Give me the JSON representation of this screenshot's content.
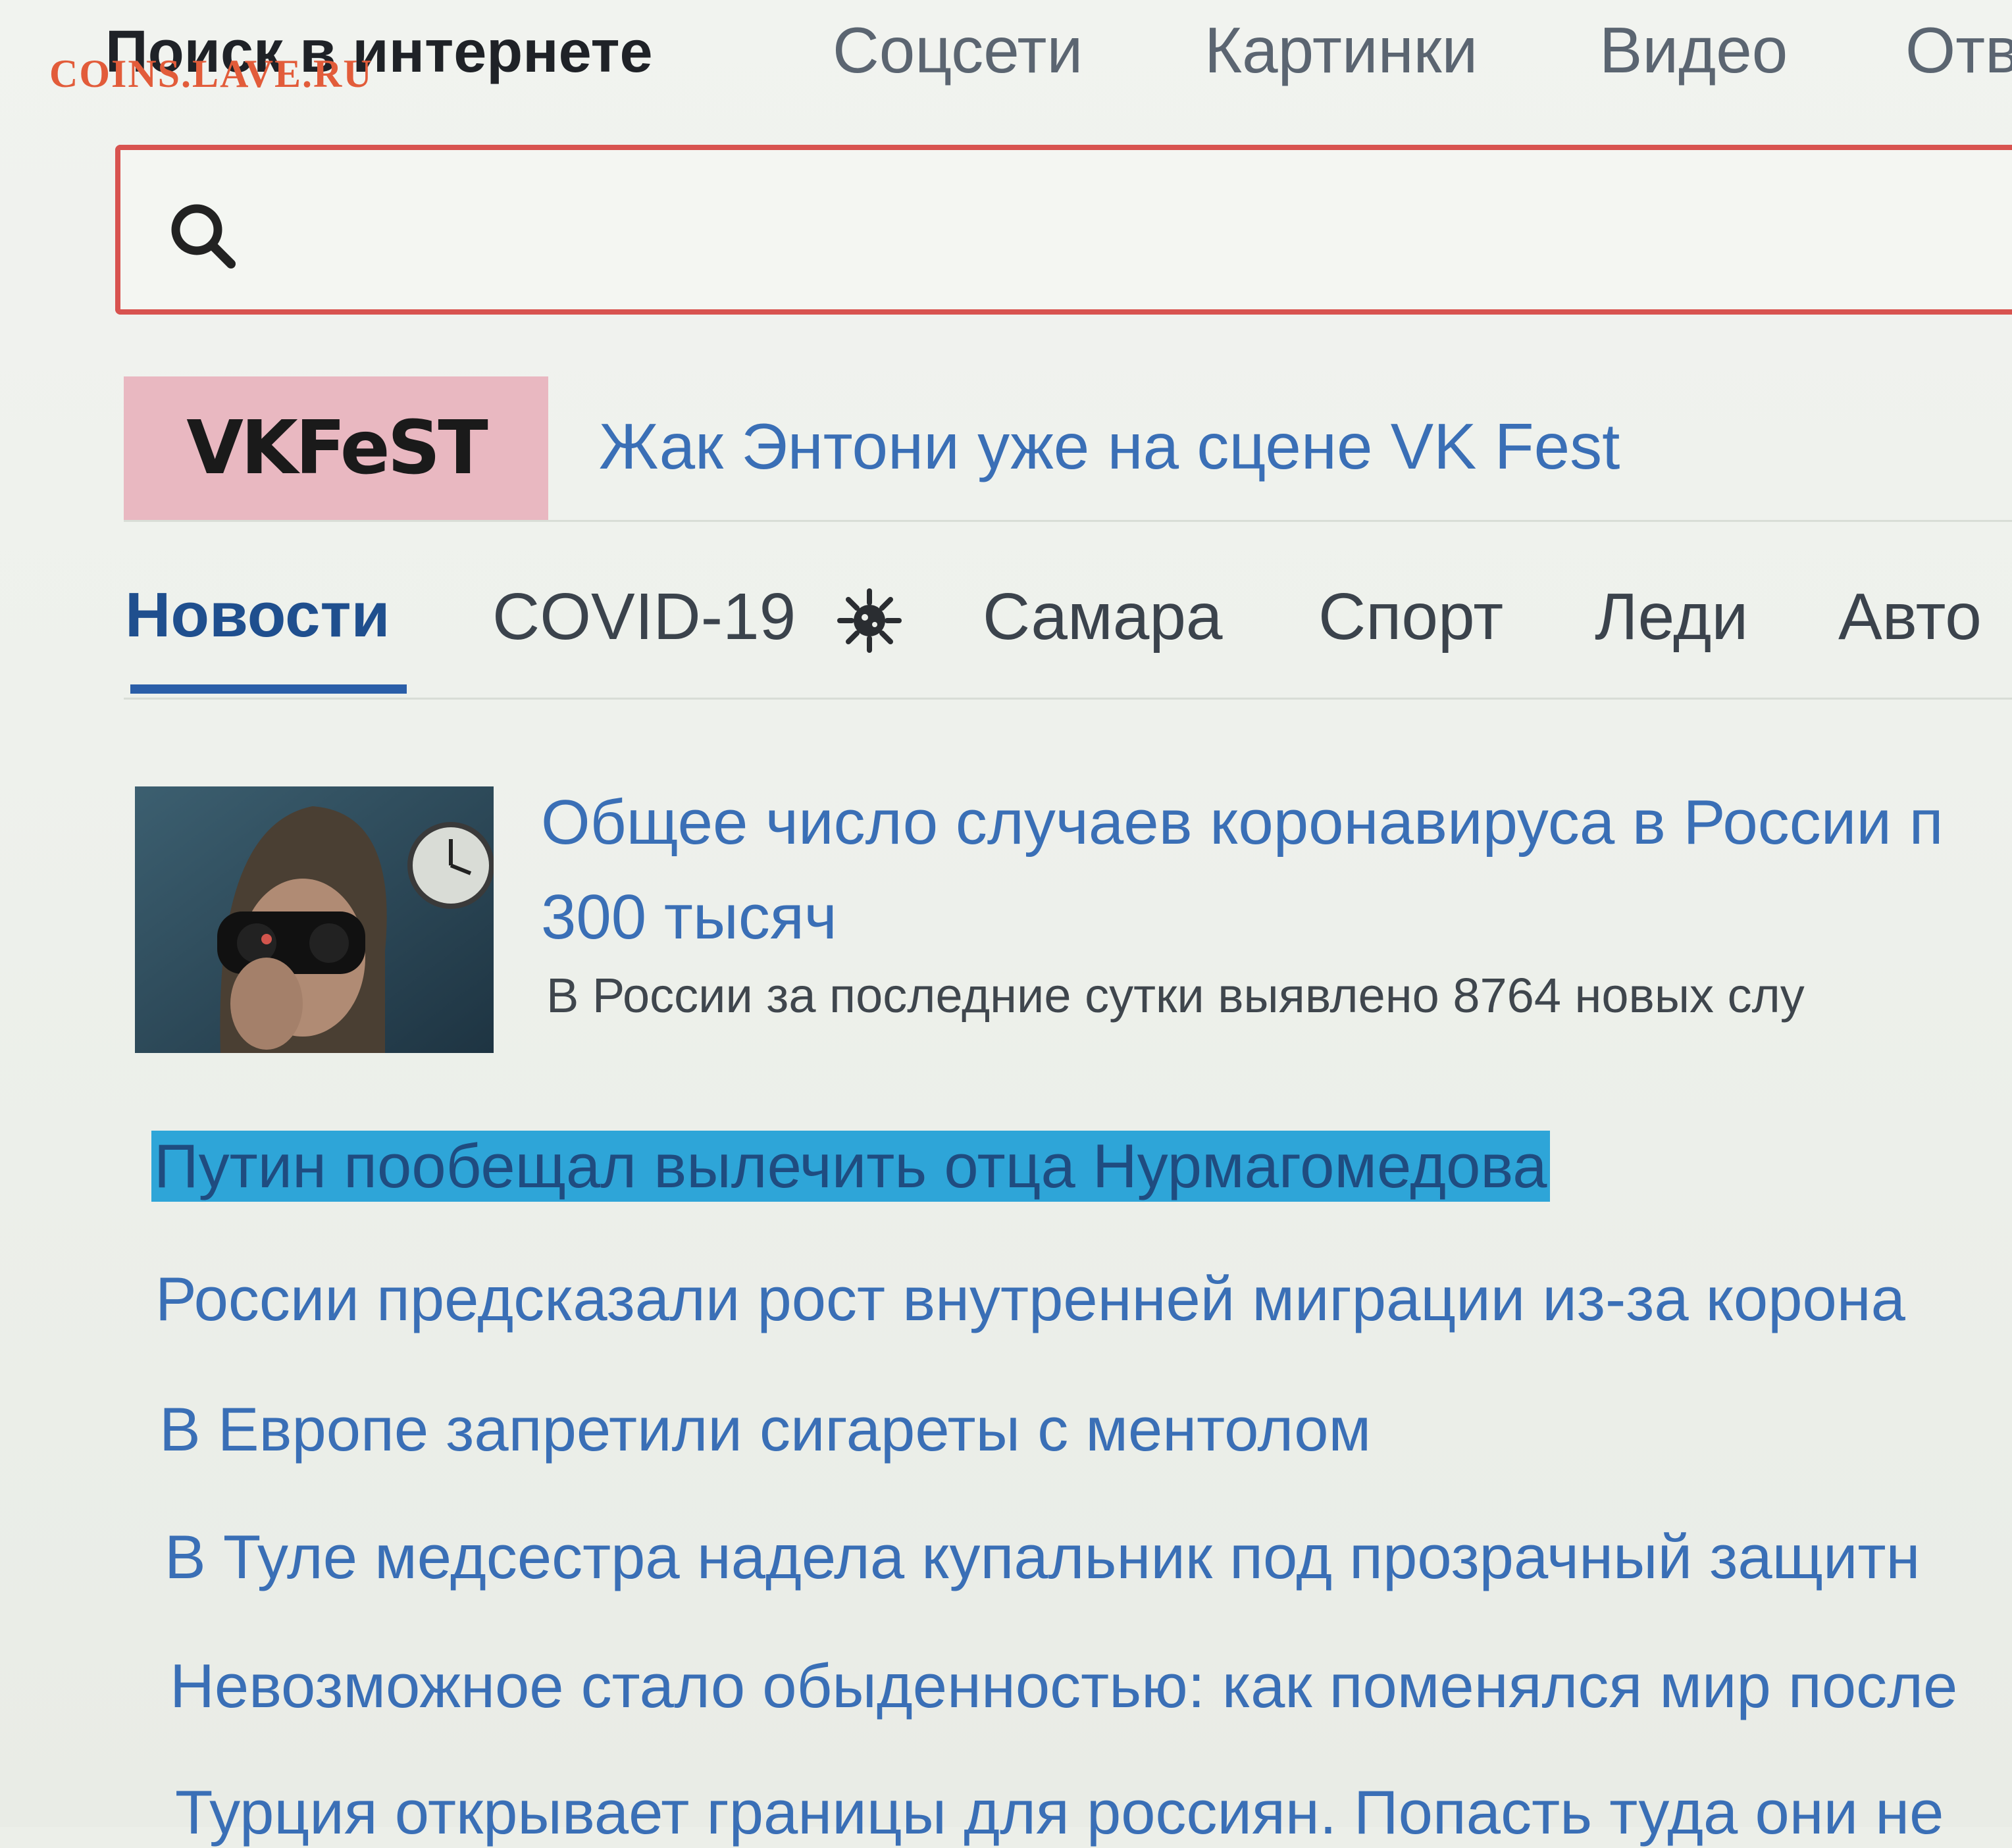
{
  "watermark": "COINS.LAVE.RU",
  "top_tabs": [
    {
      "label": "Поиск в интернете",
      "active": true
    },
    {
      "label": "Соцсети",
      "active": false
    },
    {
      "label": "Картинки",
      "active": false
    },
    {
      "label": "Видео",
      "active": false
    },
    {
      "label": "Отв",
      "active": false
    }
  ],
  "search": {
    "icon": "search-icon",
    "value": ""
  },
  "promo": {
    "logo_text": "VKFeST",
    "link_text": "Жак Энтони уже на сцене VK Fest",
    "logo_bg": "#e9b8c1"
  },
  "news_tabs": [
    {
      "label": "Новости",
      "active": true
    },
    {
      "label": "COVID-19",
      "icon": "virus-icon",
      "active": false
    },
    {
      "label": "Самара",
      "active": false
    },
    {
      "label": "Спорт",
      "active": false
    },
    {
      "label": "Леди",
      "active": false
    },
    {
      "label": "Авто",
      "active": false
    }
  ],
  "featured": {
    "title_line1": "Общее число случаев коронавируса в России п",
    "title_line2": "300 тысяч",
    "lead": "В России за последние сутки выявлено 8764 новых слу"
  },
  "headlines": [
    {
      "text": "Путин пообещал вылечить отца Нурмагомедова",
      "selected": true
    },
    {
      "text": "России предсказали рост внутренней миграции из-за корона",
      "selected": false
    },
    {
      "text": "В Европе запретили сигареты с ментолом",
      "selected": false
    },
    {
      "text": "В Туле медсестра надела купальник под прозрачный защитн",
      "selected": false
    },
    {
      "text": "Невозможное стало обыденностью: как поменялся мир после",
      "selected": false
    },
    {
      "text": "Турция открывает границы для россиян. Попасть туда они не",
      "selected": false
    }
  ],
  "colors": {
    "link": "#3a6fb6",
    "active_tab": "#1f4f8e",
    "search_border": "#d8534f",
    "selection": "#2ea5d8"
  }
}
